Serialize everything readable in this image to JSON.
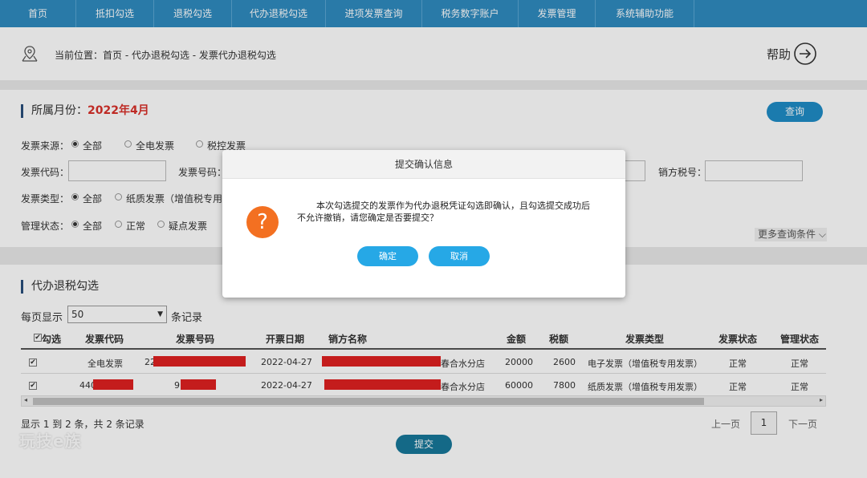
{
  "nav": {
    "items": [
      {
        "label": "首页"
      },
      {
        "label": "抵扣勾选"
      },
      {
        "label": "退税勾选"
      },
      {
        "label": "代办退税勾选"
      },
      {
        "label": "进项发票查询"
      },
      {
        "label": "税务数字账户"
      },
      {
        "label": "发票管理"
      },
      {
        "label": "系统辅助功能"
      }
    ]
  },
  "breadcrumb": {
    "text": "当前位置：首页 - 代办退税勾选 - 发票代办退税勾选",
    "help_label": "帮助"
  },
  "query": {
    "month_label": "所属月份：",
    "month_value": "2022年4月",
    "query_button": "查询",
    "source_label": "发票来源：",
    "source_options": [
      "全部",
      "全电发票",
      "税控发票"
    ],
    "code_label": "发票代码：",
    "number_label": "发票号码：",
    "seller_tax_label": "销方税号：",
    "type_label": "发票类型：",
    "type_options": [
      "全部",
      "纸质发票（增值税专用发"
    ],
    "mgmt_label": "管理状态：",
    "mgmt_options": [
      "全部",
      "正常",
      "疑点发票"
    ],
    "more_conditions": "更多查询条件"
  },
  "list": {
    "title": "代办退税勾选",
    "per_page_label": "每页显示",
    "per_page_value": "50",
    "records_label": "条记录",
    "columns": [
      "勾选",
      "发票代码",
      "发票号码",
      "开票日期",
      "销方名称",
      "金额",
      "税额",
      "发票类型",
      "发票状态",
      "管理状态"
    ],
    "rows": [
      {
        "code": "全电发票",
        "number": "22",
        "date": "2022-04-27",
        "seller": "春合水分店",
        "amount": "20000",
        "tax": "2600",
        "type": "电子发票（增值税专用发票）",
        "status": "正常",
        "mgmt": "正常"
      },
      {
        "code": "440",
        "number": "9",
        "date": "2022-04-27",
        "seller": "春合水分店",
        "amount": "60000",
        "tax": "7800",
        "type": "纸质发票（增值税专用发票）",
        "status": "正常",
        "mgmt": "正常"
      }
    ],
    "record_info": "显示 1 到 2 条，共 2 条记录",
    "prev_label": "上一页",
    "page_number": "1",
    "next_label": "下一页",
    "submit_label": "提交"
  },
  "watermark": "玩技e族",
  "dialog": {
    "title": "提交确认信息",
    "message_line1": "本次勾选提交的发票作为代办退税凭证勾选即确认，且勾选提交成功后",
    "message_line2": "不允许撤销，请您确定是否要提交？",
    "confirm_label": "确定",
    "cancel_label": "取消",
    "icon_glyph": "?"
  }
}
